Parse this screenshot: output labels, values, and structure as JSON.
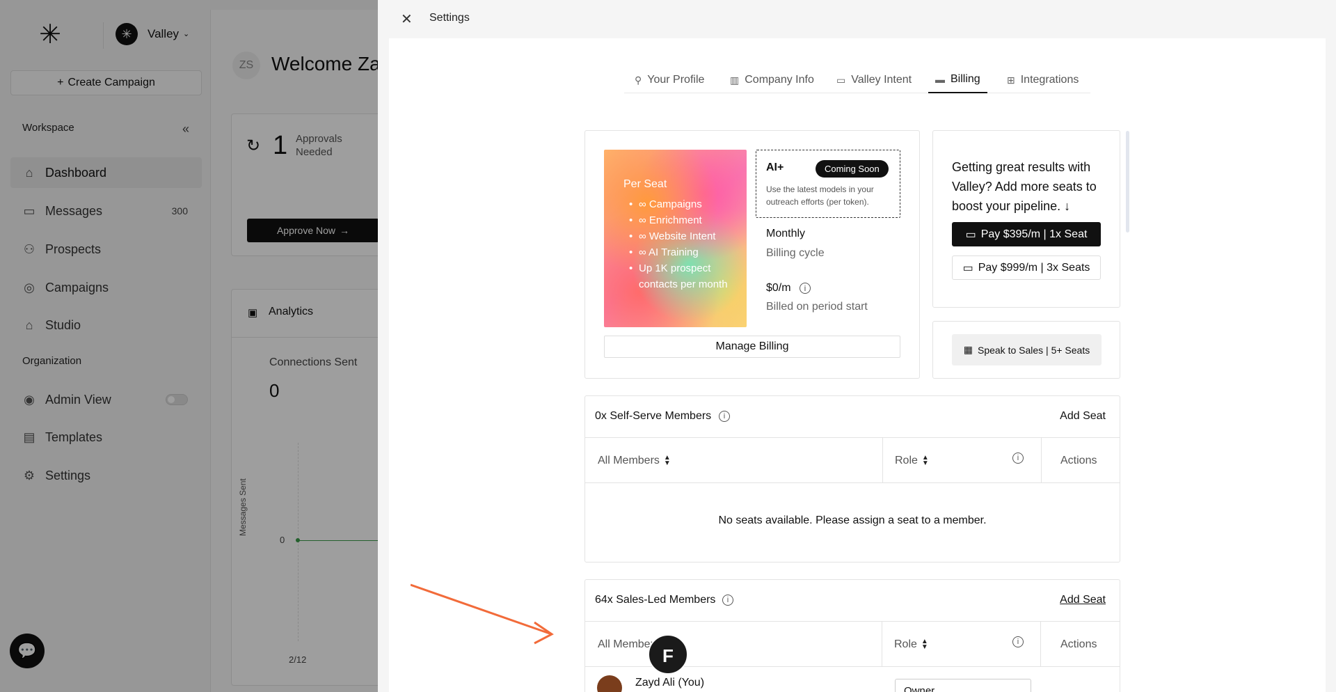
{
  "sidebar": {
    "workspace_name": "Valley",
    "create_campaign": "Create Campaign",
    "section_workspace": "Workspace",
    "section_org": "Organization",
    "items": [
      {
        "label": "Dashboard",
        "icon": "home-icon"
      },
      {
        "label": "Messages",
        "icon": "message-icon",
        "badge": "300"
      },
      {
        "label": "Prospects",
        "icon": "users-icon"
      },
      {
        "label": "Campaigns",
        "icon": "target-icon"
      },
      {
        "label": "Studio",
        "icon": "house-icon"
      }
    ],
    "org_items": [
      {
        "label": "Admin View",
        "icon": "eye-icon"
      },
      {
        "label": "Templates",
        "icon": "document-icon"
      },
      {
        "label": "Settings",
        "icon": "gear-icon"
      }
    ]
  },
  "dashboard": {
    "avatar_initials": "ZS",
    "welcome": "Welcome Zay",
    "approvals_count": "1",
    "approvals_label": "Approvals Needed",
    "approve_now": "Approve Now",
    "analytics_title": "Analytics",
    "connections_label": "Connections Sent",
    "connections_value": "0",
    "y_axis_label": "Messages Sent",
    "y_zero": "0",
    "x_date": "2/12"
  },
  "settings": {
    "title": "Settings",
    "tabs": [
      {
        "label": "Your Profile",
        "icon": "user-edit-icon"
      },
      {
        "label": "Company Info",
        "icon": "building-icon"
      },
      {
        "label": "Valley Intent",
        "icon": "window-icon"
      },
      {
        "label": "Billing",
        "icon": "credit-card-icon",
        "active": true
      },
      {
        "label": "Integrations",
        "icon": "grid-icon"
      }
    ],
    "plan": {
      "title": "Per Seat",
      "features": [
        "∞ Campaigns",
        "∞ Enrichment",
        "∞ Website Intent",
        "∞ AI Training",
        "Up 1K prospect contacts per month"
      ],
      "ai_title": "AI+",
      "coming_soon": "Coming Soon",
      "ai_desc": "Use the latest models in your outreach efforts (per token).",
      "cycle_value": "Monthly",
      "cycle_label": "Billing cycle",
      "price": "$0/m",
      "price_label": "Billed on period start",
      "manage_billing": "Manage Billing"
    },
    "upsell": {
      "text": "Getting great results with Valley? Add more seats to boost your pipeline. ↓",
      "pay1": "Pay $395/m | 1x Seat",
      "pay2": "Pay $999/m | 3x Seats",
      "sales": "Speak to Sales | 5+ Seats"
    },
    "self_serve": {
      "title": "0x Self-Serve Members",
      "add_seat": "Add Seat",
      "col_members": "All Members",
      "col_role": "Role",
      "col_actions": "Actions",
      "empty": "No seats available. Please assign a seat to a member."
    },
    "sales_led": {
      "title": "64x Sales-Led Members",
      "add_seat": "Add Seat",
      "col_members": "All Members",
      "col_role": "Role",
      "col_actions": "Actions",
      "user_name": "Zayd Ali (You)",
      "user_role": "Owner"
    }
  },
  "colors": {
    "accent_dark": "#111111",
    "annotation_arrow": "#f26b3a",
    "chart_line": "#3a9b4a"
  }
}
